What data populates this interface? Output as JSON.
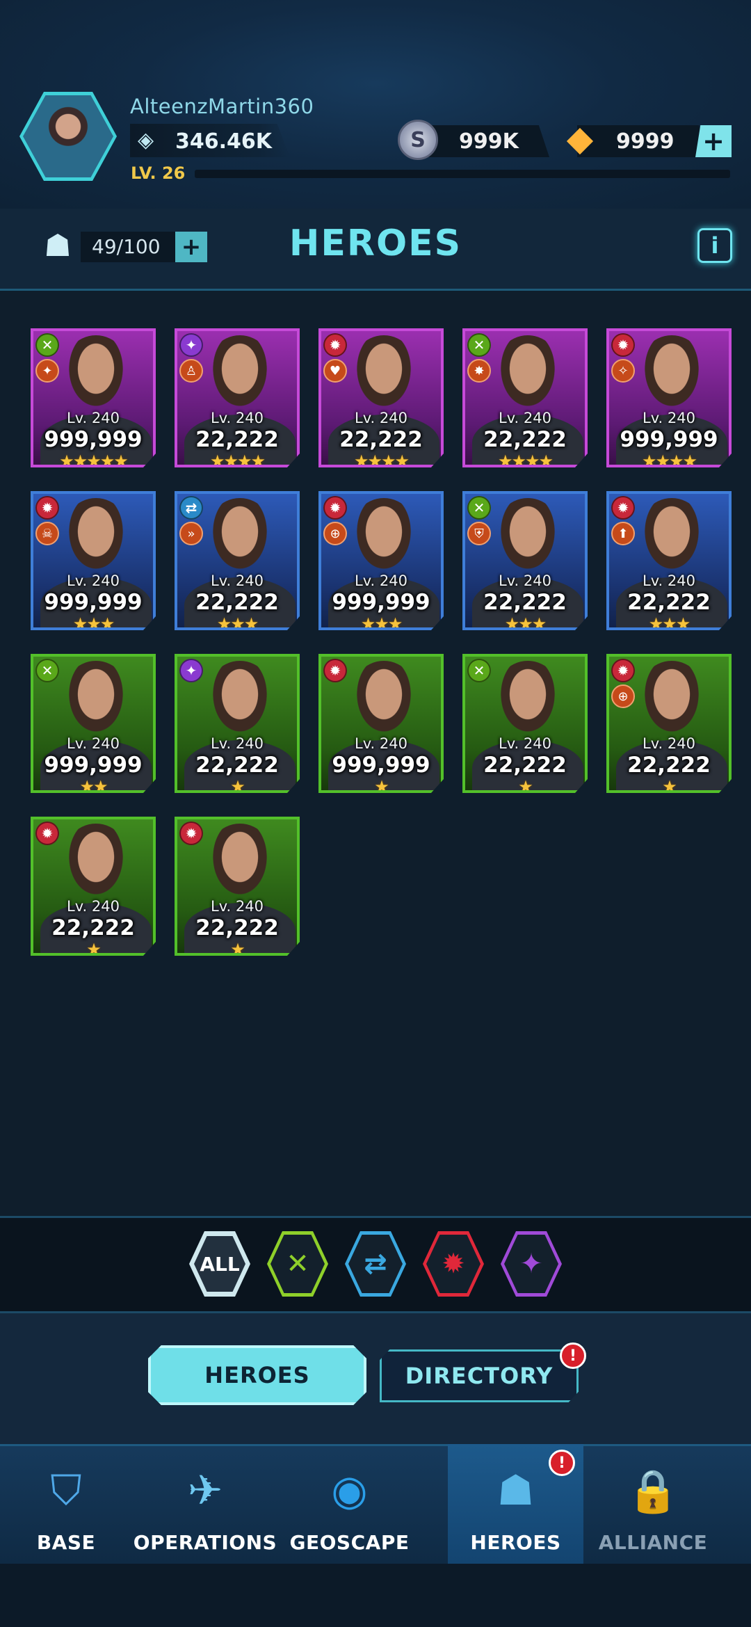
{
  "player": {
    "name": "AlteenzMartin360",
    "power": "346.46K",
    "level_label": "LV. 26",
    "xp_fraction": 0.0
  },
  "resources": {
    "silver": {
      "icon": "silver-coin-icon",
      "value": "999K"
    },
    "gold": {
      "icon": "gold-crystal-icon",
      "value": "9999"
    },
    "add_label": "+"
  },
  "roster": {
    "count": "49/100",
    "add_label": "+"
  },
  "page_title": "HEROES",
  "info_label": "i",
  "heroes": [
    {
      "level": "Lv. 240",
      "power": "999,999",
      "stars": "★★★★★",
      "rarity": "purple",
      "class": "green",
      "role": "weapon-icon"
    },
    {
      "level": "Lv. 240",
      "power": "22,222",
      "stars": "★★★★",
      "rarity": "purple",
      "class": "purple",
      "role": "soldier-icon"
    },
    {
      "level": "Lv. 240",
      "power": "22,222",
      "stars": "★★★★",
      "rarity": "purple",
      "class": "red",
      "role": "heart-icon"
    },
    {
      "level": "Lv. 240",
      "power": "22,222",
      "stars": "★★★★",
      "rarity": "purple",
      "class": "green",
      "role": "flame-icon"
    },
    {
      "level": "Lv. 240",
      "power": "999,999",
      "stars": "★★★★",
      "rarity": "purple",
      "class": "red",
      "role": "target-icon"
    },
    {
      "level": "Lv. 240",
      "power": "999,999",
      "stars": "★★★",
      "rarity": "blue",
      "class": "red",
      "role": "skull-icon"
    },
    {
      "level": "Lv. 240",
      "power": "22,222",
      "stars": "★★★",
      "rarity": "blue",
      "class": "blue",
      "role": "speed-icon"
    },
    {
      "level": "Lv. 240",
      "power": "999,999",
      "stars": "★★★",
      "rarity": "blue",
      "class": "red",
      "role": "crosshair-icon"
    },
    {
      "level": "Lv. 240",
      "power": "22,222",
      "stars": "★★★",
      "rarity": "blue",
      "class": "green",
      "role": "shield-icon"
    },
    {
      "level": "Lv. 240",
      "power": "22,222",
      "stars": "★★★",
      "rarity": "blue",
      "class": "red",
      "role": "boost-icon"
    },
    {
      "level": "Lv. 240",
      "power": "999,999",
      "stars": "★★",
      "rarity": "green",
      "class": "green",
      "role": ""
    },
    {
      "level": "Lv. 240",
      "power": "22,222",
      "stars": "★",
      "rarity": "green",
      "class": "purple",
      "role": ""
    },
    {
      "level": "Lv. 240",
      "power": "999,999",
      "stars": "★",
      "rarity": "green",
      "class": "red",
      "role": ""
    },
    {
      "level": "Lv. 240",
      "power": "22,222",
      "stars": "★",
      "rarity": "green",
      "class": "green",
      "role": ""
    },
    {
      "level": "Lv. 240",
      "power": "22,222",
      "stars": "★",
      "rarity": "green",
      "class": "red",
      "role": "crosshair-icon"
    },
    {
      "level": "Lv. 240",
      "power": "22,222",
      "stars": "★",
      "rarity": "green",
      "class": "red",
      "role": ""
    },
    {
      "level": "Lv. 240",
      "power": "22,222",
      "stars": "★",
      "rarity": "green",
      "class": "red",
      "role": ""
    }
  ],
  "filters": [
    {
      "label": "ALL",
      "icon": "all-filter-icon",
      "selected": true
    },
    {
      "label": "",
      "icon": "dna-class-icon",
      "color": "#8fd02a"
    },
    {
      "label": "",
      "icon": "tech-class-icon",
      "color": "#3aa8e0"
    },
    {
      "label": "",
      "icon": "gear-class-icon",
      "color": "#e0283a"
    },
    {
      "label": "",
      "icon": "psionic-class-icon",
      "color": "#a04ad8"
    }
  ],
  "tabs": {
    "heroes": "HEROES",
    "directory": "DIRECTORY",
    "alert": "!"
  },
  "nav": [
    {
      "label": "BASE",
      "icon": "base-icon"
    },
    {
      "label": "OPERATIONS",
      "icon": "aircraft-icon"
    },
    {
      "label": "GEOSCAPE",
      "icon": "globe-icon"
    },
    {
      "label": "HEROES",
      "icon": "helmet-icon",
      "active": true,
      "alert": "!"
    },
    {
      "label": "ALLIANCE",
      "icon": "lock-icon",
      "locked": true
    }
  ],
  "colors": {
    "accent": "#6fe4ef",
    "purple_rarity": "#c64ad8",
    "blue_rarity": "#3f7ed8",
    "green_rarity": "#53c02a",
    "star": "#f6c33c",
    "alert": "#d81f2a"
  }
}
